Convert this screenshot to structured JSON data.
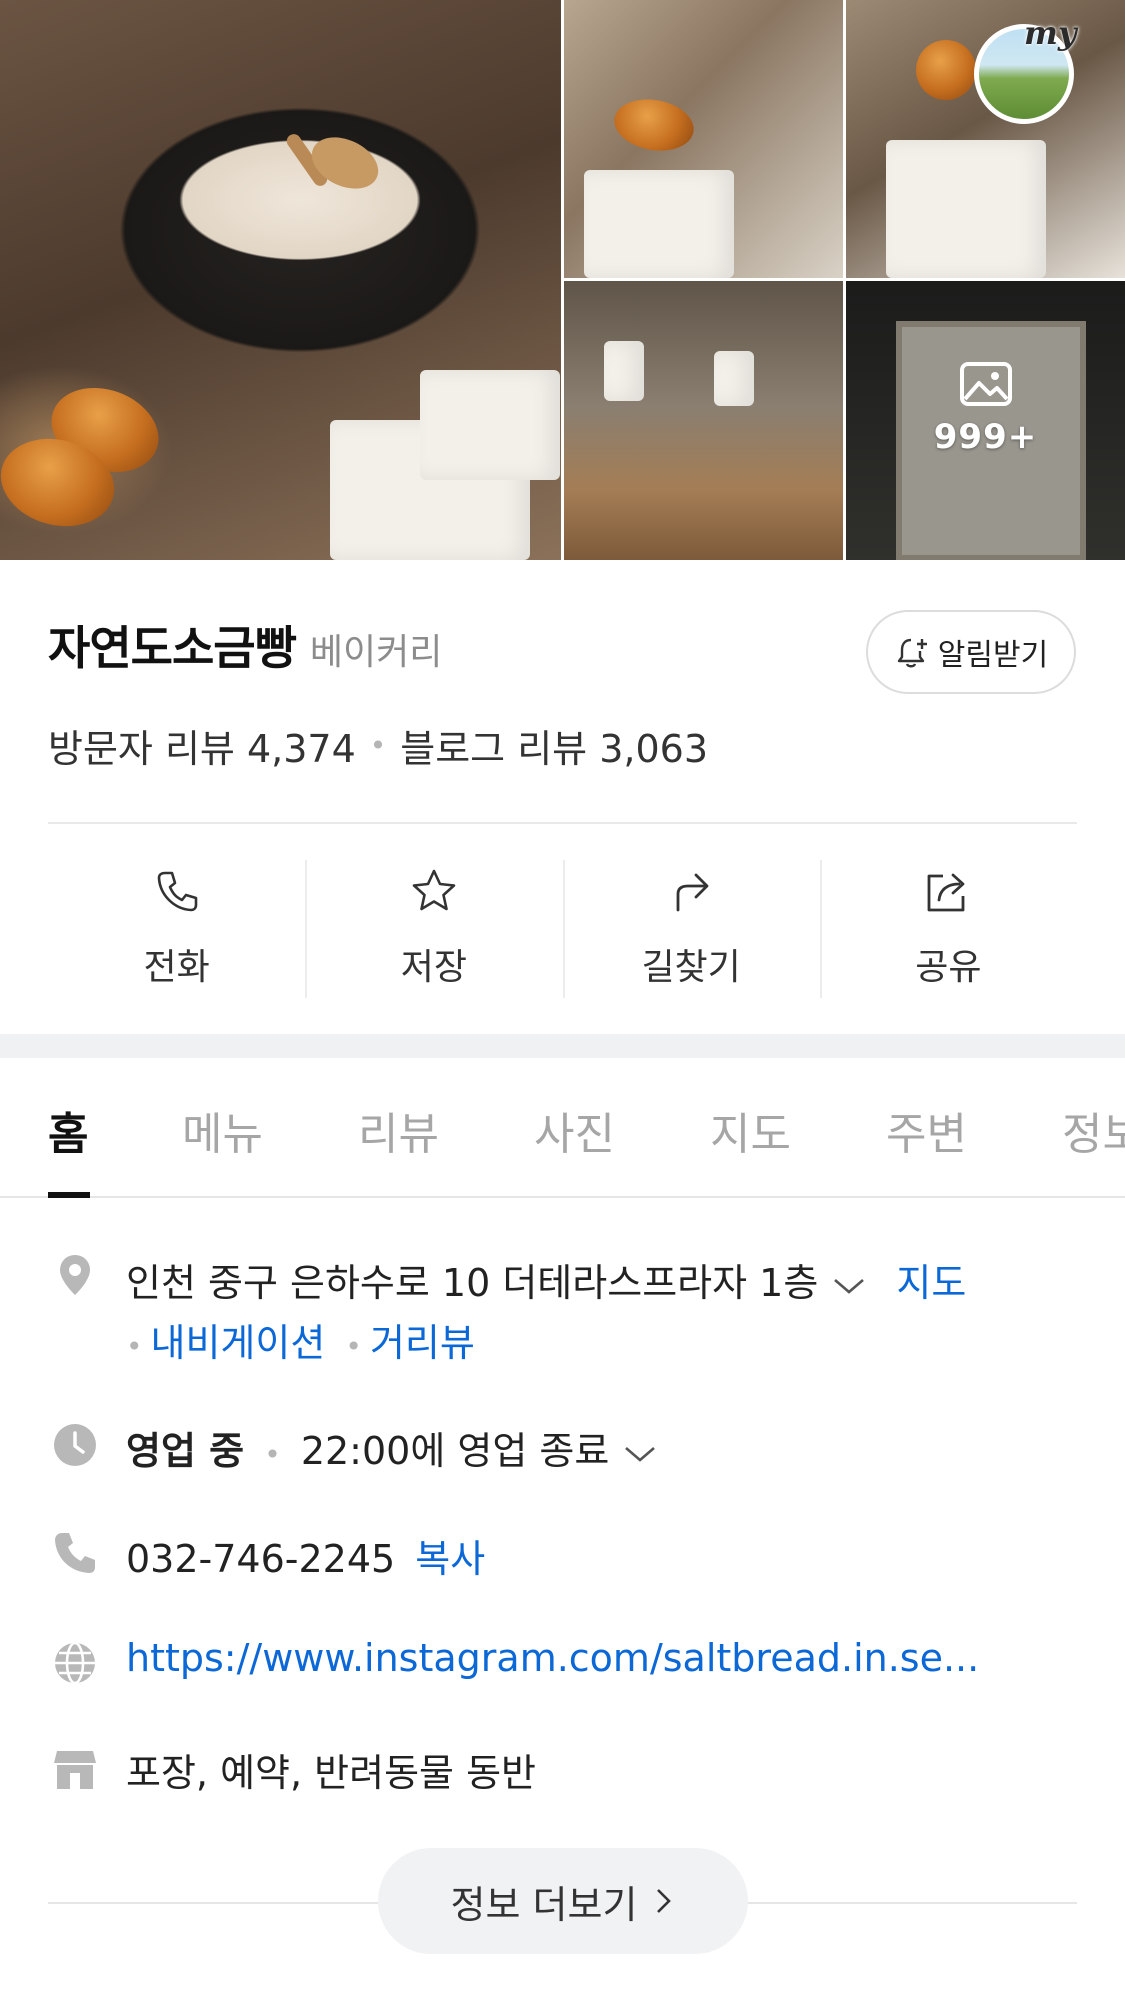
{
  "gallery": {
    "more_count": "999+",
    "profile_badge": "my"
  },
  "place": {
    "name": "자연도소금빵",
    "category": "베이커리",
    "notify_label": "알림받기",
    "visitor_review": "방문자 리뷰 4,374",
    "blog_review": "블로그 리뷰 3,063"
  },
  "actions": [
    {
      "label": "전화",
      "icon": "phone-icon"
    },
    {
      "label": "저장",
      "icon": "star-icon"
    },
    {
      "label": "길찾기",
      "icon": "directions-icon"
    },
    {
      "label": "공유",
      "icon": "share-icon"
    }
  ],
  "tabs": [
    "홈",
    "메뉴",
    "리뷰",
    "사진",
    "지도",
    "주변",
    "정보"
  ],
  "info": {
    "address": "인천 중구 은하수로 10 더테라스프라자 1층",
    "map_link": "지도",
    "navigation_link": "내비게이션",
    "street_view_link": "거리뷰",
    "status": "영업 중",
    "hours": "22:00에 영업 종료",
    "phone": "032-746-2245",
    "copy_label": "복사",
    "website": "https://www.instagram.com/saltbread.in.se...",
    "amenities": "포장, 예약, 반려동물 동반"
  },
  "more_info_label": "정보 더보기",
  "colors": {
    "link": "#0b68d6",
    "muted": "#8c8c8c",
    "icon_gray": "#b8b8b8"
  }
}
